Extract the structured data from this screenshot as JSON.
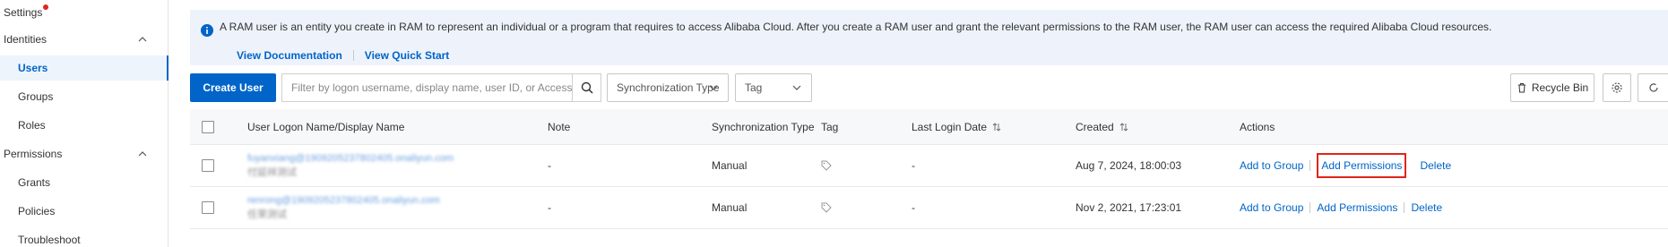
{
  "sidebar": {
    "settings_label": "Settings",
    "identities_label": "Identities",
    "users_label": "Users",
    "groups_label": "Groups",
    "roles_label": "Roles",
    "permissions_label": "Permissions",
    "grants_label": "Grants",
    "policies_label": "Policies",
    "troubleshoot_label": "Troubleshoot"
  },
  "notice": {
    "text": "A RAM user is an entity you create in RAM to represent an individual or a program that requires to access Alibaba Cloud. After you create a RAM user and grant the relevant permissions to the RAM user, the RAM user can access the required Alibaba Cloud resources.",
    "link_documentation": "View Documentation",
    "link_quick_start": "View Quick Start"
  },
  "toolbar": {
    "create_user_label": "Create User",
    "search_placeholder": "Filter by logon username, display name, user ID, or AccessKey ID",
    "sync_type_label": "Synchronization Type",
    "tag_label": "Tag",
    "recycle_bin_label": "Recycle Bin"
  },
  "table": {
    "headers": {
      "user": "User Logon Name/Display Name",
      "note": "Note",
      "sync_type": "Synchronization Type",
      "tag": "Tag",
      "last_login": "Last Login Date",
      "created": "Created",
      "actions": "Actions"
    },
    "rows": [
      {
        "logon_name": "fuyanxiang@1909205237802405.onaliyun.com",
        "display_name": "付延祥测试",
        "note": "-",
        "sync_type": "Manual",
        "last_login": "-",
        "created": "Aug 7, 2024, 18:00:03"
      },
      {
        "logon_name": "renrong@1909205237802405.onaliyun.com",
        "display_name": "任荣测试",
        "note": "-",
        "sync_type": "Manual",
        "last_login": "-",
        "created": "Nov 2, 2021, 17:23:01"
      }
    ],
    "actions": {
      "add_to_group": "Add to Group",
      "add_permissions": "Add Permissions",
      "delete": "Delete"
    }
  },
  "colors": {
    "primary": "#0064c8",
    "highlight": "#e1251b",
    "notice_bg": "#eef3fb"
  }
}
